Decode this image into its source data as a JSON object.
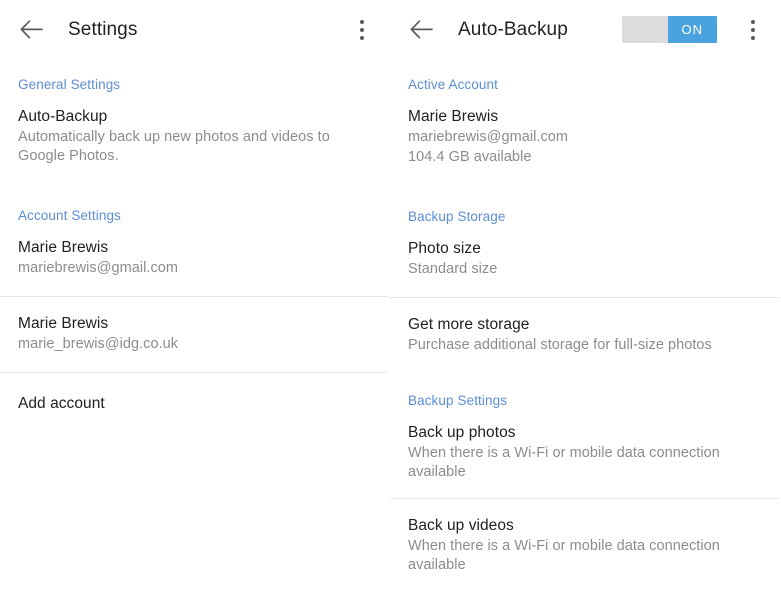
{
  "left_panel": {
    "appbar": {
      "back_icon": "arrow-left-icon",
      "title": "Settings",
      "overflow_icon": "more-vertical-icon"
    },
    "sections": [
      {
        "header": "General Settings",
        "rows": [
          {
            "title": "Auto-Backup",
            "sub": "Automatically back up new photos and videos to Google Photos."
          }
        ]
      },
      {
        "header": "Account Settings",
        "rows": [
          {
            "title": "Marie Brewis",
            "sub": "mariebrewis@gmail.com"
          },
          {
            "title": "Marie Brewis",
            "sub": "marie_brewis@idg.co.uk"
          },
          {
            "title": "Add account",
            "sub": ""
          }
        ]
      }
    ]
  },
  "right_panel": {
    "appbar": {
      "back_icon": "arrow-left-icon",
      "title": "Auto-Backup",
      "toggle": {
        "state": "on",
        "label": "ON",
        "on_color": "#4aa3df",
        "off_color": "#dcdcdc"
      },
      "overflow_icon": "more-vertical-icon"
    },
    "sections": [
      {
        "header": "Active Account",
        "rows": [
          {
            "title": "Marie Brewis",
            "sub": "mariebrewis@gmail.com",
            "sub2": "104.4 GB available"
          }
        ]
      },
      {
        "header": "Backup Storage",
        "rows": [
          {
            "title": "Photo size",
            "sub": "Standard size"
          },
          {
            "title": "Get more storage",
            "sub": "Purchase additional storage for full-size photos"
          }
        ]
      },
      {
        "header": "Backup Settings",
        "rows": [
          {
            "title": "Back up photos",
            "sub": "When there is a Wi-Fi or mobile data connection available"
          },
          {
            "title": "Back up videos",
            "sub": "When there is a Wi-Fi or mobile data connection available"
          }
        ]
      }
    ]
  },
  "colors": {
    "accent_blue": "#5b8dd6",
    "toggle_blue": "#4aa3df",
    "title_text": "#212121",
    "sub_text": "#8c8c8c",
    "divider": "#e8e8e8"
  }
}
